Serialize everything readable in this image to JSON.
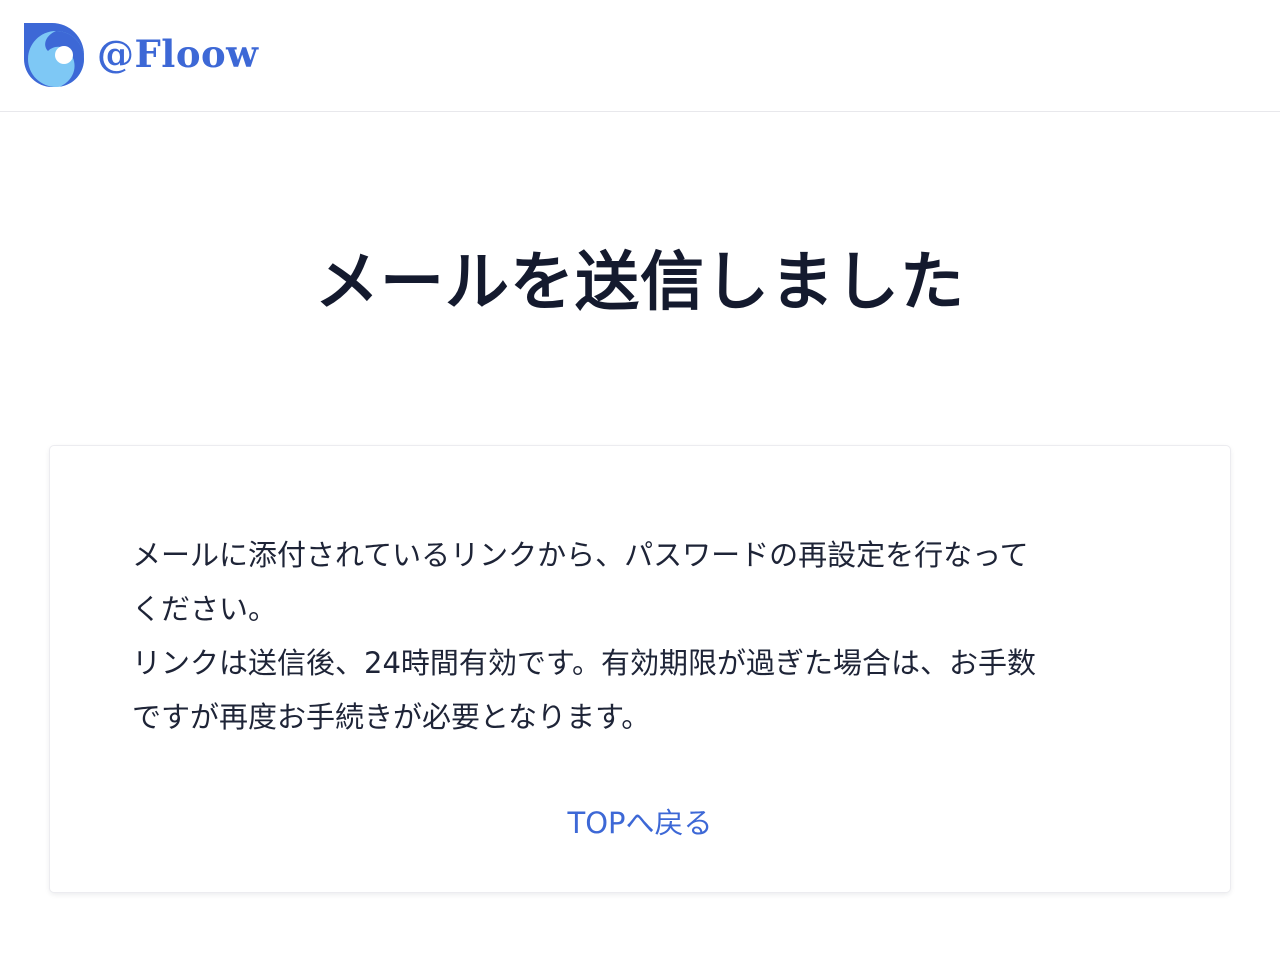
{
  "brand": {
    "name": "@Floow",
    "primary_color": "#3d68d6",
    "light_color": "#7ec8f5",
    "logo_icon": "floow-logo-icon"
  },
  "main": {
    "title": "メールを送信しました",
    "message_lines": [
      "メールに添付されているリンクから、パスワードの再設定を行なって",
      "ください。",
      "リンクは送信後、24時間有効です。有効期限が過ぎた場合は、お手数",
      "ですが再度お手続きが必要となります。"
    ],
    "top_link_label": "TOPへ戻る"
  }
}
